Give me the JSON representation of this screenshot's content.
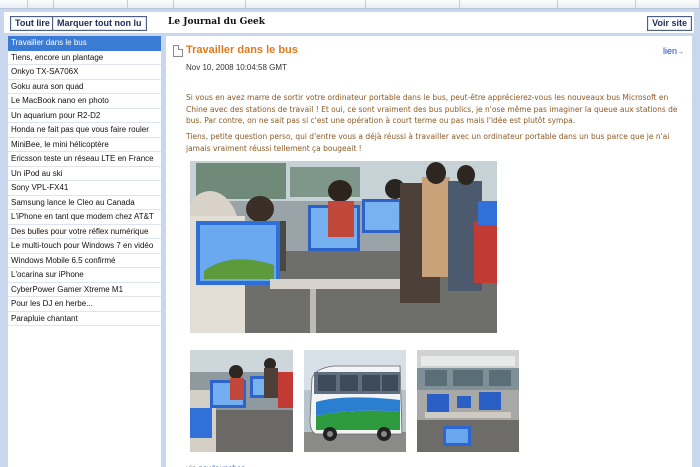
{
  "toolbar": {
    "tout_lire": "Tout lire",
    "marquer": "Marquer tout non lu",
    "feed_name": "Le Journal du Geek",
    "voir_site": "Voir site"
  },
  "sidebar": {
    "items": [
      "Travailler dans le bus",
      "Tiens, encore un plantage",
      "Onkyo TX-SA706X",
      "Goku aura son quad",
      "Le MacBook nano en photo",
      "Un aquarium pour R2-D2",
      "Honda ne fait pas que vous faire rouler",
      "MiniBee, le mini hélicoptère",
      "Ericsson teste un réseau LTE en France",
      "Un iPod au ski",
      "Sony VPL-FX41",
      "Samsung lance le Cleo au Canada",
      "L'iPhone en tant que modem chez AT&T",
      "Des bulles pour votre réflex numérique",
      "Le multi-touch pour Windows 7 en vidéo",
      "Windows Mobile 6.5 confirmé",
      "L'ocarina sur iPhone",
      "CyberPower Gamer Xtreme M1",
      "Pour les DJ en herbe...",
      "Parapluie chantant"
    ]
  },
  "article": {
    "title": "Travailler dans le bus",
    "lien": "lien",
    "date": "Nov 10, 2008 10:04:58 GMT",
    "p1": "Si vous en avez marre de sortir votre ordinateur portable dans le bus, peut-être apprécierez-vous les nouveaux bus Microsoft en Chine avec des stations de travail ! Et oui, ce sont vraiment des bus publics, je n'ose même pas imaginer la queue aux stations de bus. Par contre, on ne sait pas si c'est une opération à court terme ou pas mais l'idée est plutôt sympa.",
    "p2": "Tiens, petite question perso, qui d'entre vous a déjà réussi à travailler avec un ordinateur portable dans un bus parce que je n'ai jamais vraiment réussi tellement ça bougeait !",
    "via_label": "via",
    "via_link": "newlaunches"
  },
  "colors": {
    "accent": "#3a7bd5",
    "title": "#e07a1a",
    "body_text": "#8b5a24",
    "link": "#1a47b8",
    "frame": "#c8d7ee"
  }
}
